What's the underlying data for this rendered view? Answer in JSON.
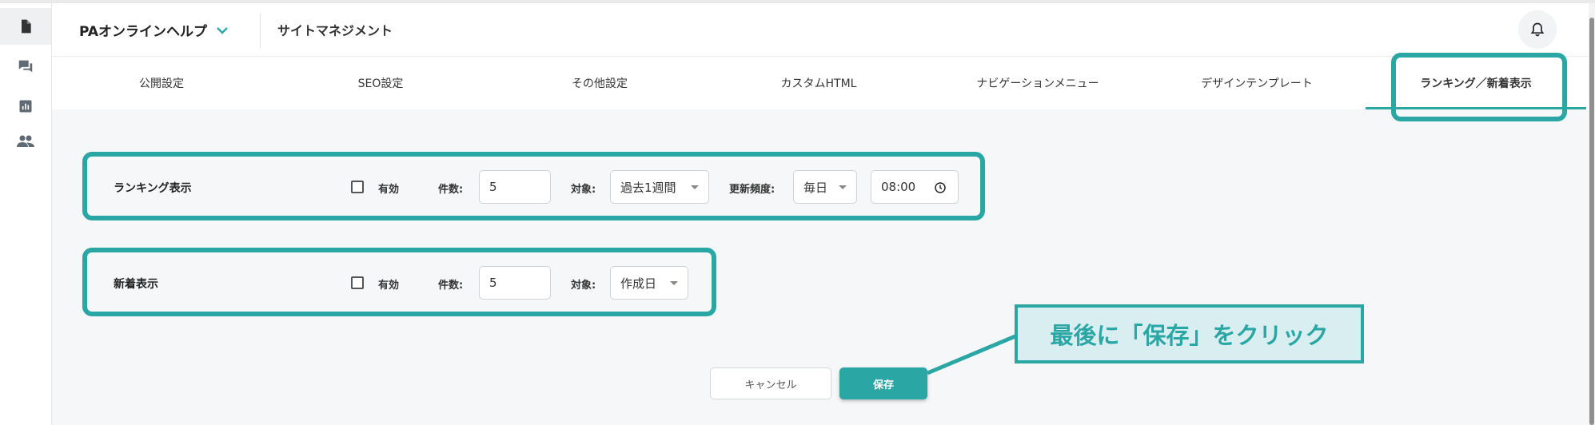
{
  "rail": {
    "items": [
      {
        "icon": "document-icon",
        "active": true
      },
      {
        "icon": "chat-icon",
        "active": false
      },
      {
        "icon": "bar-chart-icon",
        "active": false
      },
      {
        "icon": "people-icon",
        "active": false
      }
    ]
  },
  "header": {
    "site_name": "PAオンラインヘルプ",
    "page_name": "サイトマネジメント",
    "bell_icon": "bell-icon"
  },
  "tabs": [
    {
      "label": "公開設定"
    },
    {
      "label": "SEO設定"
    },
    {
      "label": "その他設定"
    },
    {
      "label": "カスタムHTML"
    },
    {
      "label": "ナビゲーションメニュー"
    },
    {
      "label": "デザインテンプレート"
    },
    {
      "label": "ランキング／新着表示",
      "active": true
    }
  ],
  "ranking": {
    "label": "ランキング表示",
    "enabled_label": "有効",
    "enabled": false,
    "count_label": "件数:",
    "count_value": "5",
    "target_label": "対象:",
    "target_value": "過去1週間",
    "frequency_label": "更新頻度:",
    "frequency_value": "毎日",
    "time_value": "08:00"
  },
  "new_arrivals": {
    "label": "新着表示",
    "enabled_label": "有効",
    "enabled": false,
    "count_label": "件数:",
    "count_value": "5",
    "target_label": "対象:",
    "target_value": "作成日"
  },
  "actions": {
    "cancel_label": "キャンセル",
    "save_label": "保存"
  },
  "callout": {
    "text": "最後に「保存」をクリック"
  },
  "colors": {
    "accent": "#2aa7a5",
    "callout_bg": "#d9eef0",
    "content_bg": "#f6f7f9"
  }
}
